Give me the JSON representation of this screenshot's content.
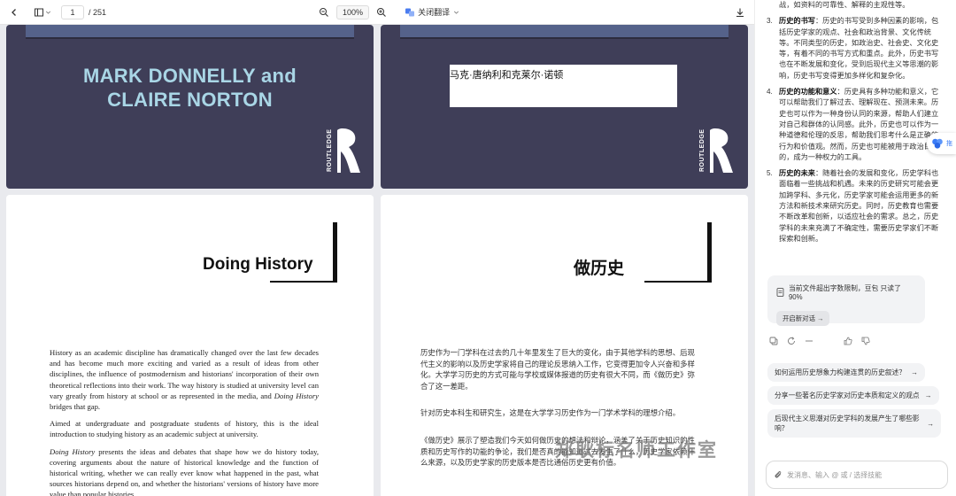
{
  "toolbar": {
    "page_current": "1",
    "page_total": "/ 251",
    "zoom": "100%",
    "translate_label": "关闭翻译"
  },
  "cover": {
    "authors_en_line1": "MARK DONNELLY and",
    "authors_en_line2": "CLAIRE NORTON",
    "authors_zh": "马克·唐纳利和克莱尔·诺顿",
    "publisher_logo": "ROUTLEDGE"
  },
  "page_en": {
    "title": "Doing History",
    "para1_a": "History as an academic discipline has dramatically changed over the last few decades and has become much more exciting and varied as a result of ideas from other disciplines, the influence of postmodernism and historians' incorporation of their own theoretical reflections into their work. The way history is studied at university level can vary greatly from history at school or as represented in the media, and ",
    "para1_italic": "Doing History",
    "para1_b": " bridges that gap.",
    "para2": "Aimed at undergraduate and postgraduate students of history, this is the ideal introduction to studying history as an academic subject at university.",
    "para3_italic": "Doing History",
    "para3": " presents the ideas and debates that shape how we do history today, covering arguments about the nature of historical knowledge and the function of historical writing, whether we can really ever know what happened in the past, what sources historians depend on, and whether the historians' versions of history have more value than popular histories."
  },
  "page_zh": {
    "title": "做历史",
    "para1": "历史作为一门学科在过去的几十年里发生了巨大的变化，由于其他学科的思想、后现代主义的影响以及历史学家将自己的理论反思纳入工作，它变得更加令人兴奋和多样化。大学学习历史的方式可能与学校或媒体报道的历史有很大不同，而《做历史》弥合了这一差距。",
    "para2": "针对历史本科生和研究生，这是在大学学习历史作为一门学术学科的理想介绍。",
    "para3": "《做历史》展示了塑造我们今天如何做历史的想法和辩论，涵盖了关于历史知识的性质和历史写作的功能的争论，我们是否真的能知道过去发生了什么，历史学家依赖什么来源，以及历史学家的历史版本是否比通俗历史更有价值。"
  },
  "watermark": "郑耿标名师工作室",
  "panel": {
    "intro": "战，如资料的可靠性、解释的主观性等。",
    "items": [
      {
        "num": "3.",
        "title": "历史的书写",
        "text": "：历史的书写受到多种因素的影响，包括历史学家的观点、社会和政治背景、文化传统等。不同类型的历史，如政治史、社会史、文化史等，有着不同的书写方式和重点。此外，历史书写也在不断发展和变化，受到后现代主义等思潮的影响，历史书写变得更加多样化和复杂化。"
      },
      {
        "num": "4.",
        "title": "历史的功能和意义",
        "text": "：历史具有多种功能和意义，它可以帮助我们了解过去、理解现在、预测未来。历史也可以作为一种身份认同的来源，帮助人们建立对自己和群体的认同感。此外，历史也可以作为一种道德和伦理的反思，帮助我们思考什么是正确的行为和价值观。然而，历史也可能被用于政治目的，成为一种权力的工具。"
      },
      {
        "num": "5.",
        "title": "历史的未来",
        "text": "：随着社会的发展和变化，历史学科也面临着一些挑战和机遇。未来的历史研究可能会更加跨学科、多元化，历史学家可能会运用更多的新方法和新技术来研究历史。同时，历史教育也需要不断改革和创新，以适应社会的需求。总之，历史学科的未来充满了不确定性，需要历史学家们不断探索和创新。"
      }
    ],
    "notice": "当前文件超出字数限制，豆包 只读了 90%",
    "new_chat": "开启新对话",
    "suggestions": [
      "如何运用历史想象力构建连贯的历史叙述？",
      "分享一些著名历史学家对历史本质和定义的观点",
      "后现代主义思潮对历史学科的发展产生了哪些影响？"
    ],
    "input_placeholder": "发消息、输入 @ 或 / 选择技能",
    "side_tab_label": "拖"
  }
}
